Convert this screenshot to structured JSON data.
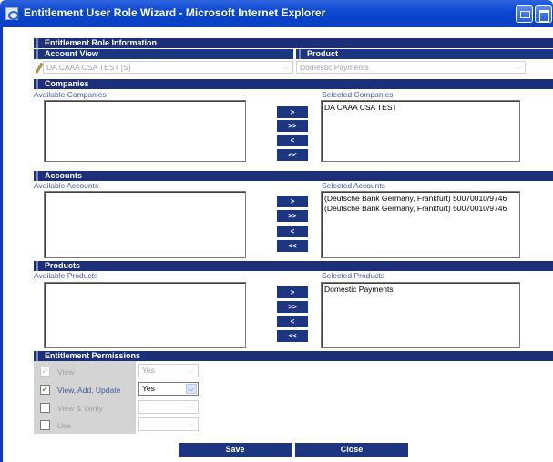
{
  "window": {
    "title": "Entitlement User Role Wizard - Microsoft Internet Explorer"
  },
  "role_info": {
    "header": "Entitlement Role Information",
    "account_view_header": "Account View",
    "product_header": "Product",
    "account_view_value": "DA CAAA CSA TEST [S]",
    "product_value": "Domestic Payments"
  },
  "companies": {
    "header": "Companies",
    "available_label": "Available Companies",
    "selected_label": "Selected Companies",
    "available": [],
    "selected": [
      "DA CAAA CSA TEST"
    ]
  },
  "accounts": {
    "header": "Accounts",
    "available_label": "Available Accounts",
    "selected_label": "Selected Accounts",
    "available": [],
    "selected": [
      "(Deutsche Bank Germany, Frankfurt) 50070010/9746",
      "(Deutsche Bank Germany, Frankfurt) 50070010/9746"
    ]
  },
  "products": {
    "header": "Products",
    "available_label": "Available Products",
    "selected_label": "Selected Products",
    "available": [],
    "selected": [
      "Domestic Payments"
    ]
  },
  "move_buttons": {
    "add": ">",
    "add_all": ">>",
    "remove": "<",
    "remove_all": "<<"
  },
  "permissions": {
    "header": "Entitlement Permissions",
    "items": [
      {
        "label": "View",
        "checked": true,
        "enabled": false,
        "value": "Yes"
      },
      {
        "label": "View, Add, Update",
        "checked": true,
        "enabled": true,
        "value": "Yes"
      },
      {
        "label": "View & Verify",
        "checked": false,
        "enabled": false,
        "value": ""
      },
      {
        "label": "Use",
        "checked": false,
        "enabled": false,
        "value": ""
      }
    ]
  },
  "actions": {
    "save": "Save",
    "close": "Close"
  }
}
